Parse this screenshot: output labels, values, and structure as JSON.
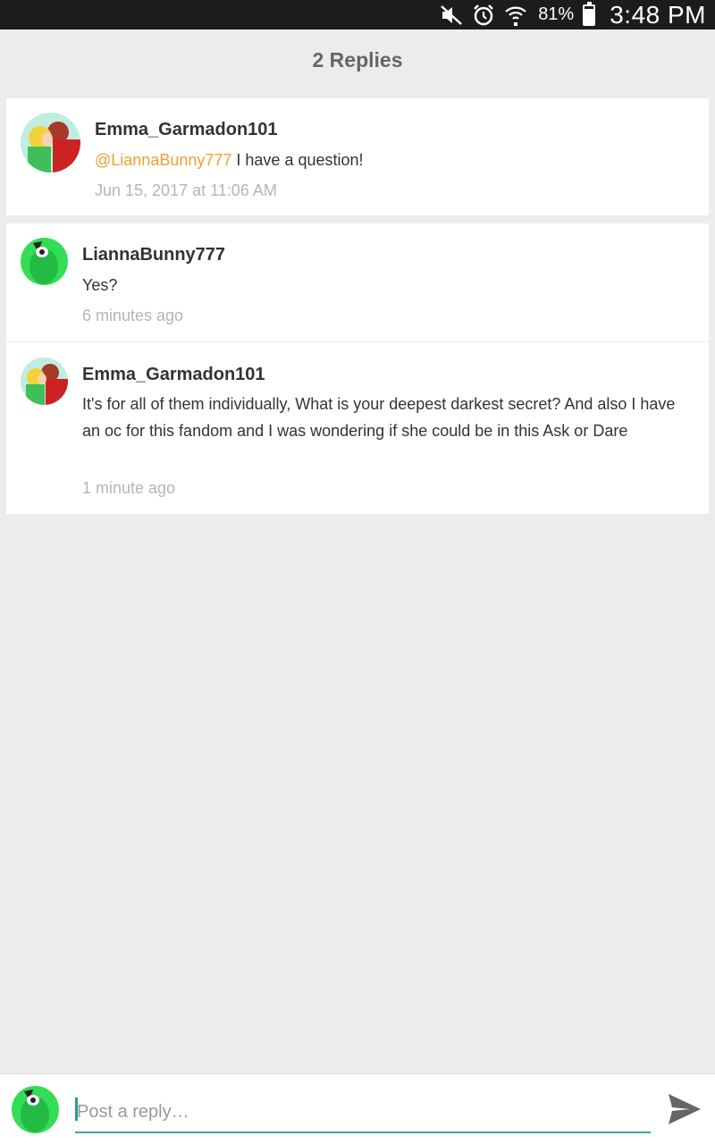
{
  "status_bar": {
    "icons": [
      "mute-icon",
      "alarm-icon",
      "wifi-icon"
    ],
    "battery_percent": "81%",
    "battery_level": 0.81,
    "time": "3:48 PM"
  },
  "header": {
    "title": "2 Replies"
  },
  "parent_comment": {
    "username": "Emma_Garmadon101",
    "mention": "@LiannaBunny777",
    "text": " I have a question!",
    "timestamp": "Jun 15, 2017 at 11:06 AM"
  },
  "replies": [
    {
      "username": "LiannaBunny777",
      "text": "Yes?",
      "timestamp": "6 minutes ago"
    },
    {
      "username": "Emma_Garmadon101",
      "text": "It's for all of them individually, What is your deepest darkest secret? And also I have an oc for this fandom and I was wondering if she could be in this Ask or Dare",
      "timestamp": "1 minute ago"
    }
  ],
  "composer": {
    "placeholder": "Post a reply…",
    "send_icon": "send-icon"
  },
  "colors": {
    "mention": "#f0a030",
    "accent": "#3aa7a3",
    "background": "#ececec"
  }
}
